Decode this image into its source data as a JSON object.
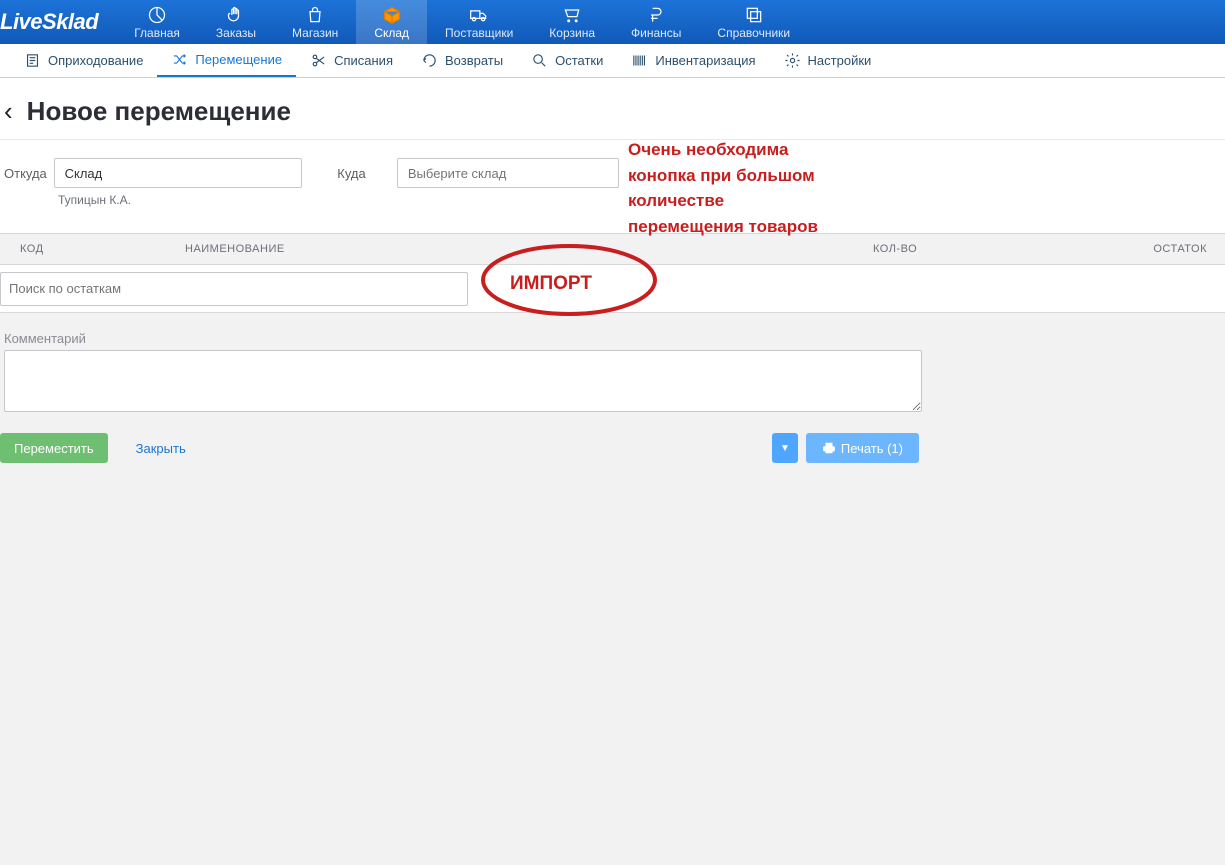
{
  "brand": "LiveSklad",
  "nav": {
    "home": "Главная",
    "orders": "Заказы",
    "shop": "Магазин",
    "warehouse": "Склад",
    "suppliers": "Поставщики",
    "cart": "Корзина",
    "finance": "Финансы",
    "refs": "Справочники"
  },
  "subtabs": {
    "receipt": "Оприходование",
    "transfer": "Перемещение",
    "writeoff": "Списания",
    "returns": "Возвраты",
    "stock": "Остатки",
    "inventory": "Инвентаризация",
    "settings": "Настройки"
  },
  "page_title": "Новое перемещение",
  "form": {
    "from_label": "Откуда",
    "from_value": "Склад",
    "from_sub": "Тупицын К.А.",
    "to_label": "Куда",
    "to_placeholder": "Выберите склад"
  },
  "columns": {
    "code": "КОД",
    "name": "НАИМЕНОВАНИЕ",
    "qty": "КОЛ-ВО",
    "remain": "ОСТАТОК"
  },
  "search_placeholder": "Поиск по остаткам",
  "import_label": "ИМПОРТ",
  "annotation": "Очень необходима\nконопка при большом\nколичестве\nперемещения товаров",
  "comment_label": "Комментарий",
  "buttons": {
    "move": "Переместить",
    "close": "Закрыть",
    "print": "Печать (1)"
  }
}
